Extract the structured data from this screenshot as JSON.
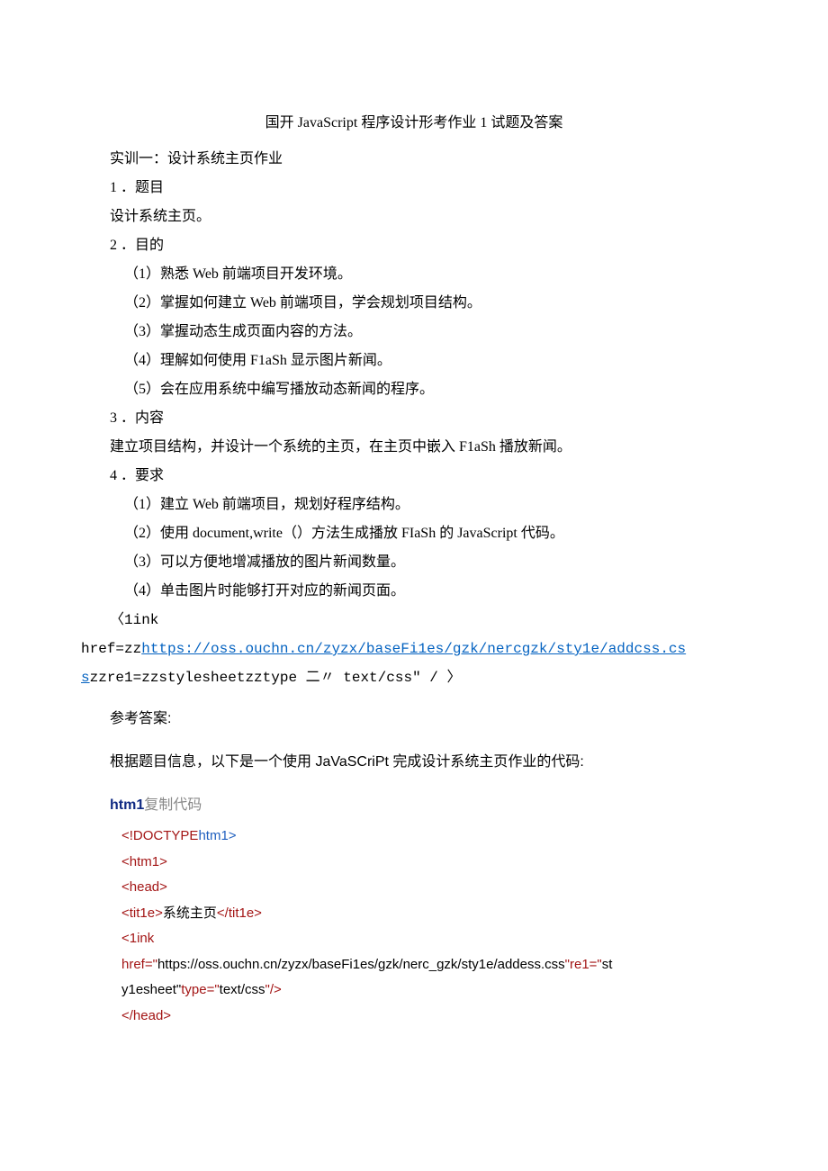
{
  "title": "国开 JavaScript 程序设计形考作业 1 试题及答案",
  "sx_heading": "实训一：设计系统主页作业",
  "sec1_h": "1 ．题目",
  "sec1_b": "设计系统主页。",
  "sec2_h": "2 ．目的",
  "sec2_items": [
    "（1）熟悉 Web 前端项目开发环境。",
    "（2）掌握如何建立 Web 前端项目，学会规划项目结构。",
    "（3）掌握动态生成页面内容的方法。",
    "（4）理解如何使用 F1aSh 显示图片新闻。",
    "（5）会在应用系统中编写播放动态新闻的程序。"
  ],
  "sec3_h": "3 ．内容",
  "sec3_b": "建立项目结构，并设计一个系统的主页，在主页中嵌入 F1aSh 播放新闻。",
  "sec4_h": "4 ．要求",
  "sec4_items": [
    "（1）建立 Web 前端项目，规划好程序结构。",
    "（2）使用 document,write（）方法生成播放 FIaSh 的 JavaScript 代码。",
    "（3）可以方便地增减播放的图片新闻数量。",
    "（4）单击图片时能够打开对应的新闻页面。"
  ],
  "link_open": "〈1ink",
  "href_prefix": "href=",
  "z1": "zz",
  "link_url1": "https://oss.ouchn.cn/zyzx/baseFi1es/gzk/nercgzk/sty1e/addcss.cs",
  "link_url2": "s",
  "rel_fragment": "re1=",
  "rel_val": "stylesheet",
  "type_fragment": "type 二〃 text/css\" / 〉",
  "answer_label": "参考答案:",
  "answer_intro": "根据题目信息，以下是一个使用 JaVaSCriPt 完成设计系统主页作业的代码:",
  "code_header_bold": "htm1",
  "code_header_gray": "复制代码",
  "code": {
    "l1_a": "<!DOCTYPE",
    "l1_b": "htm1>",
    "l2": "<htm1>",
    "l3": "<head>",
    "l4_a": "<tit1e>",
    "l4_b": "系统主页",
    "l4_c": "</tit1e>",
    "l5": "<1ink",
    "l6_a": "href=\"",
    "l6_b": "https://oss.ouchn.cn/zyzx/baseFi1es/gzk/nerc_gzk/sty1e/addess.css",
    "l6_c": "\"re1=\"",
    "l6_d": "st",
    "l7_a": "y1esheet\"",
    "l7_b": "type=\"",
    "l7_c": "text/css",
    "l7_d": "\"/>",
    "l8": "</head>"
  }
}
